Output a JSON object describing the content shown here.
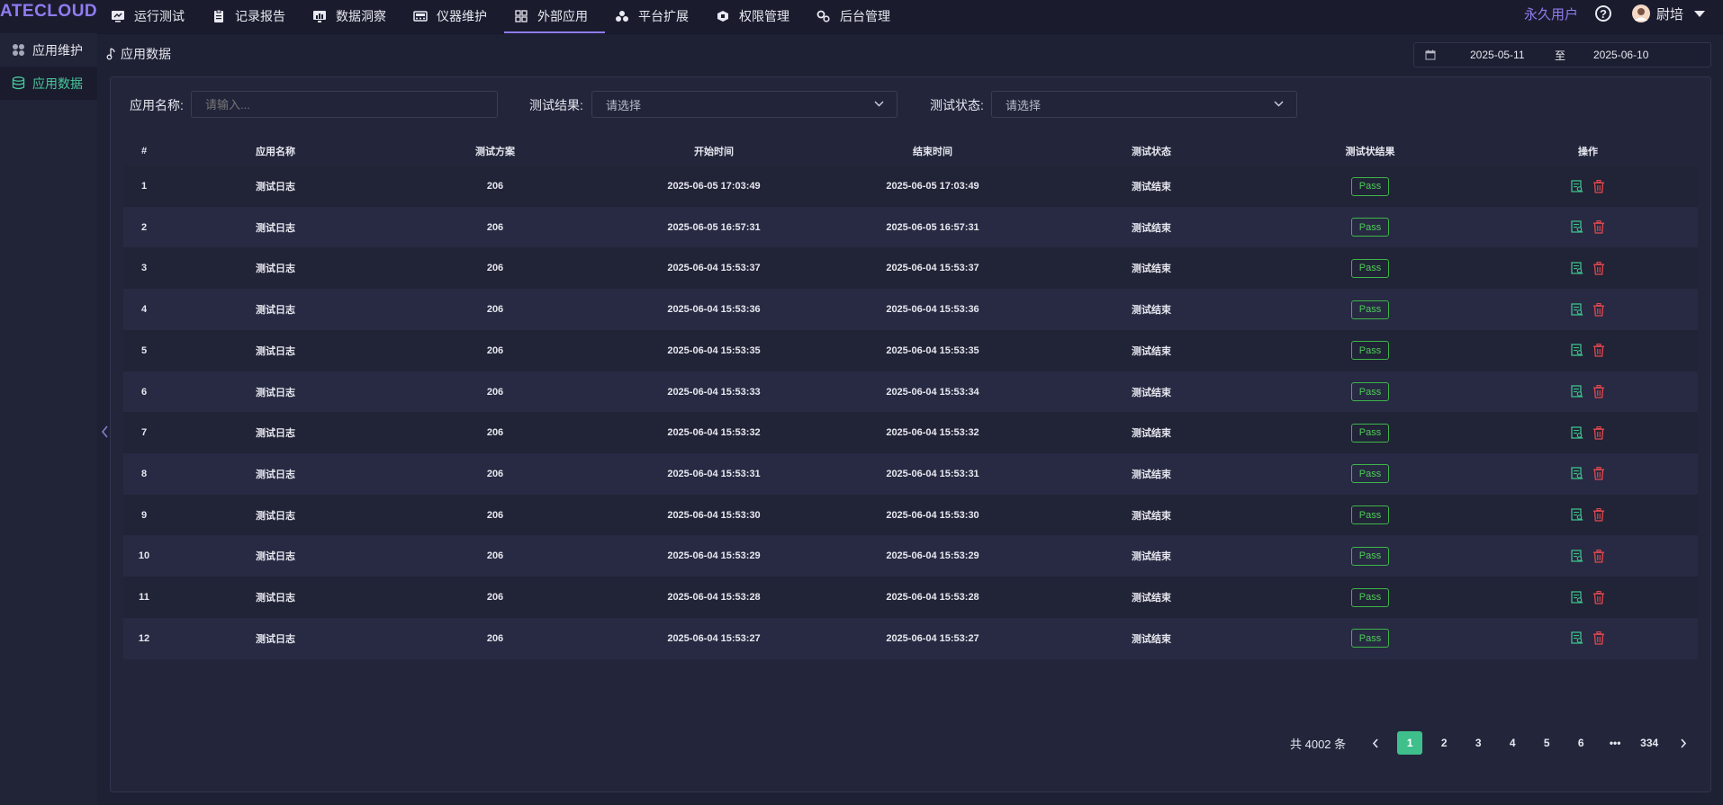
{
  "app": {
    "logo": "ATECLOUD"
  },
  "nav": [
    {
      "label": "运行测试",
      "icon": "monitor-icon"
    },
    {
      "label": "记录报告",
      "icon": "clipboard-icon"
    },
    {
      "label": "数据洞察",
      "icon": "chart-icon"
    },
    {
      "label": "仪器维护",
      "icon": "instrument-icon"
    },
    {
      "label": "外部应用",
      "icon": "grid-icon",
      "active": true
    },
    {
      "label": "平台扩展",
      "icon": "extension-icon"
    },
    {
      "label": "权限管理",
      "icon": "permission-icon"
    },
    {
      "label": "后台管理",
      "icon": "admin-icon"
    }
  ],
  "user": {
    "type": "永久用户",
    "name": "尉培"
  },
  "sidebar": [
    {
      "label": "应用维护",
      "icon": "apps-icon"
    },
    {
      "label": "应用数据",
      "icon": "database-icon",
      "active": true
    }
  ],
  "page": {
    "title": "应用数据"
  },
  "date_range": {
    "start": "2025-05-11",
    "separator": "至",
    "end": "2025-06-10"
  },
  "filters": {
    "app_name": {
      "label": "应用名称:",
      "placeholder": "请输入..."
    },
    "test_result": {
      "label": "测试结果:",
      "value": "请选择"
    },
    "test_status": {
      "label": "测试状态:",
      "value": "请选择"
    }
  },
  "table": {
    "headers": [
      "#",
      "应用名称",
      "测试方案",
      "开始时间",
      "结束时间",
      "测试状态",
      "测试状结果",
      "操作"
    ],
    "rows": [
      {
        "no": "1",
        "app": "测试日志",
        "plan": "206",
        "start": "2025-06-05 17:03:49",
        "end": "2025-06-05 17:03:49",
        "status": "测试结束",
        "result": "Pass"
      },
      {
        "no": "2",
        "app": "测试日志",
        "plan": "206",
        "start": "2025-06-05 16:57:31",
        "end": "2025-06-05 16:57:31",
        "status": "测试结束",
        "result": "Pass"
      },
      {
        "no": "3",
        "app": "测试日志",
        "plan": "206",
        "start": "2025-06-04 15:53:37",
        "end": "2025-06-04 15:53:37",
        "status": "测试结束",
        "result": "Pass"
      },
      {
        "no": "4",
        "app": "测试日志",
        "plan": "206",
        "start": "2025-06-04 15:53:36",
        "end": "2025-06-04 15:53:36",
        "status": "测试结束",
        "result": "Pass"
      },
      {
        "no": "5",
        "app": "测试日志",
        "plan": "206",
        "start": "2025-06-04 15:53:35",
        "end": "2025-06-04 15:53:35",
        "status": "测试结束",
        "result": "Pass"
      },
      {
        "no": "6",
        "app": "测试日志",
        "plan": "206",
        "start": "2025-06-04 15:53:33",
        "end": "2025-06-04 15:53:34",
        "status": "测试结束",
        "result": "Pass"
      },
      {
        "no": "7",
        "app": "测试日志",
        "plan": "206",
        "start": "2025-06-04 15:53:32",
        "end": "2025-06-04 15:53:32",
        "status": "测试结束",
        "result": "Pass"
      },
      {
        "no": "8",
        "app": "测试日志",
        "plan": "206",
        "start": "2025-06-04 15:53:31",
        "end": "2025-06-04 15:53:31",
        "status": "测试结束",
        "result": "Pass"
      },
      {
        "no": "9",
        "app": "测试日志",
        "plan": "206",
        "start": "2025-06-04 15:53:30",
        "end": "2025-06-04 15:53:30",
        "status": "测试结束",
        "result": "Pass"
      },
      {
        "no": "10",
        "app": "测试日志",
        "plan": "206",
        "start": "2025-06-04 15:53:29",
        "end": "2025-06-04 15:53:29",
        "status": "测试结束",
        "result": "Pass"
      },
      {
        "no": "11",
        "app": "测试日志",
        "plan": "206",
        "start": "2025-06-04 15:53:28",
        "end": "2025-06-04 15:53:28",
        "status": "测试结束",
        "result": "Pass"
      },
      {
        "no": "12",
        "app": "测试日志",
        "plan": "206",
        "start": "2025-06-04 15:53:27",
        "end": "2025-06-04 15:53:27",
        "status": "测试结束",
        "result": "Pass"
      }
    ]
  },
  "pagination": {
    "total": "共 4002 条",
    "pages": [
      "1",
      "2",
      "3",
      "4",
      "5",
      "6",
      "•••",
      "334"
    ],
    "current": "1"
  },
  "colors": {
    "accent": "#8f7cf2",
    "green": "#3fbf8b",
    "danger": "#e5484d"
  }
}
